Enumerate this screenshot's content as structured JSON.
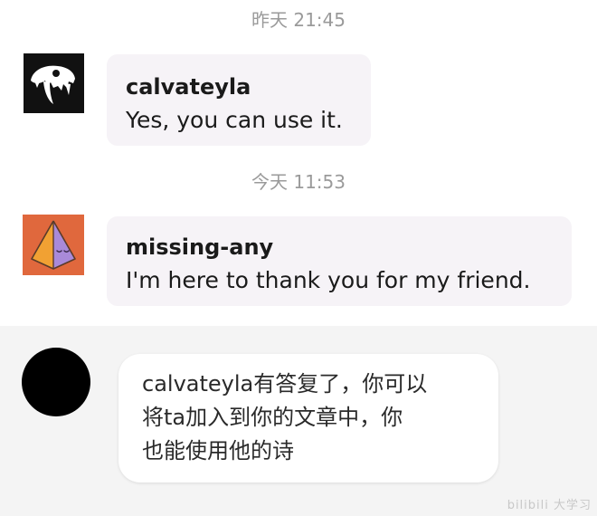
{
  "messages": [
    {
      "timestamp": "昨天 21:45",
      "username": "calvateyla",
      "text": "Yes, you can use it.",
      "avatar_icon": "skull-icon"
    },
    {
      "timestamp": "今天 11:53",
      "username": "missing-any",
      "text": "I'm here to thank you for my friend.",
      "avatar_icon": "pyramid-icon"
    }
  ],
  "reply": {
    "avatar_icon": "black-circle-avatar",
    "lines": [
      "calvateyla有答复了，你可以",
      "将ta加入到你的文章中，你",
      "也能使用他的诗"
    ]
  },
  "watermark": "bilibili 大学习",
  "colors": {
    "bubble": "#f6f3f7",
    "panel": "#f4f4f4",
    "timestamp": "#9a9a9a",
    "avatar2_bg": "#e0683d",
    "pyramid_purple": "#a98ad9",
    "pyramid_orange": "#f1a133"
  }
}
